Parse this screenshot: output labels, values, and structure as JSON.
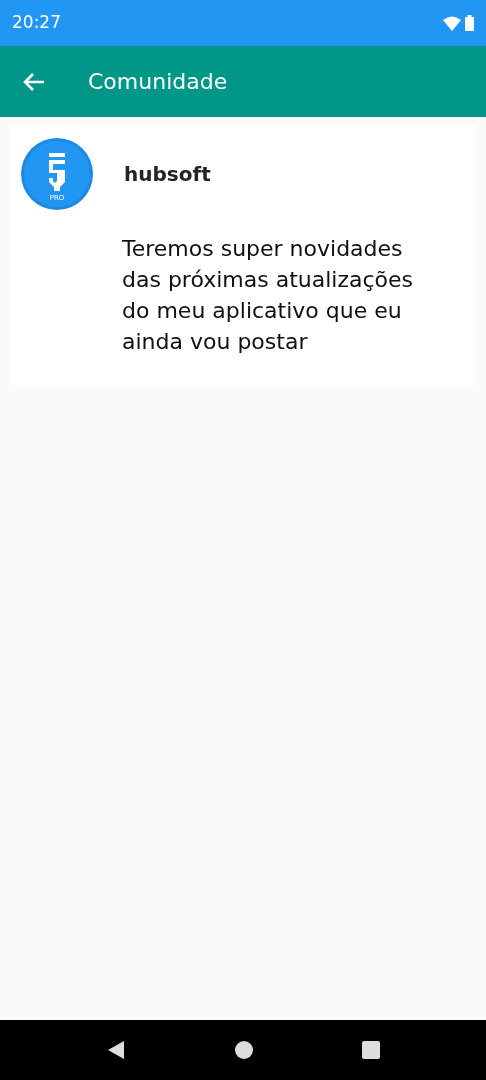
{
  "status_bar": {
    "time": "20:27"
  },
  "app_bar": {
    "title": "Comunidade"
  },
  "posts": [
    {
      "author": "hubsoft",
      "avatar_label": "PRO",
      "text": "Teremos super novidades das próximas atualizações do meu aplicativo que eu ainda vou postar"
    }
  ]
}
